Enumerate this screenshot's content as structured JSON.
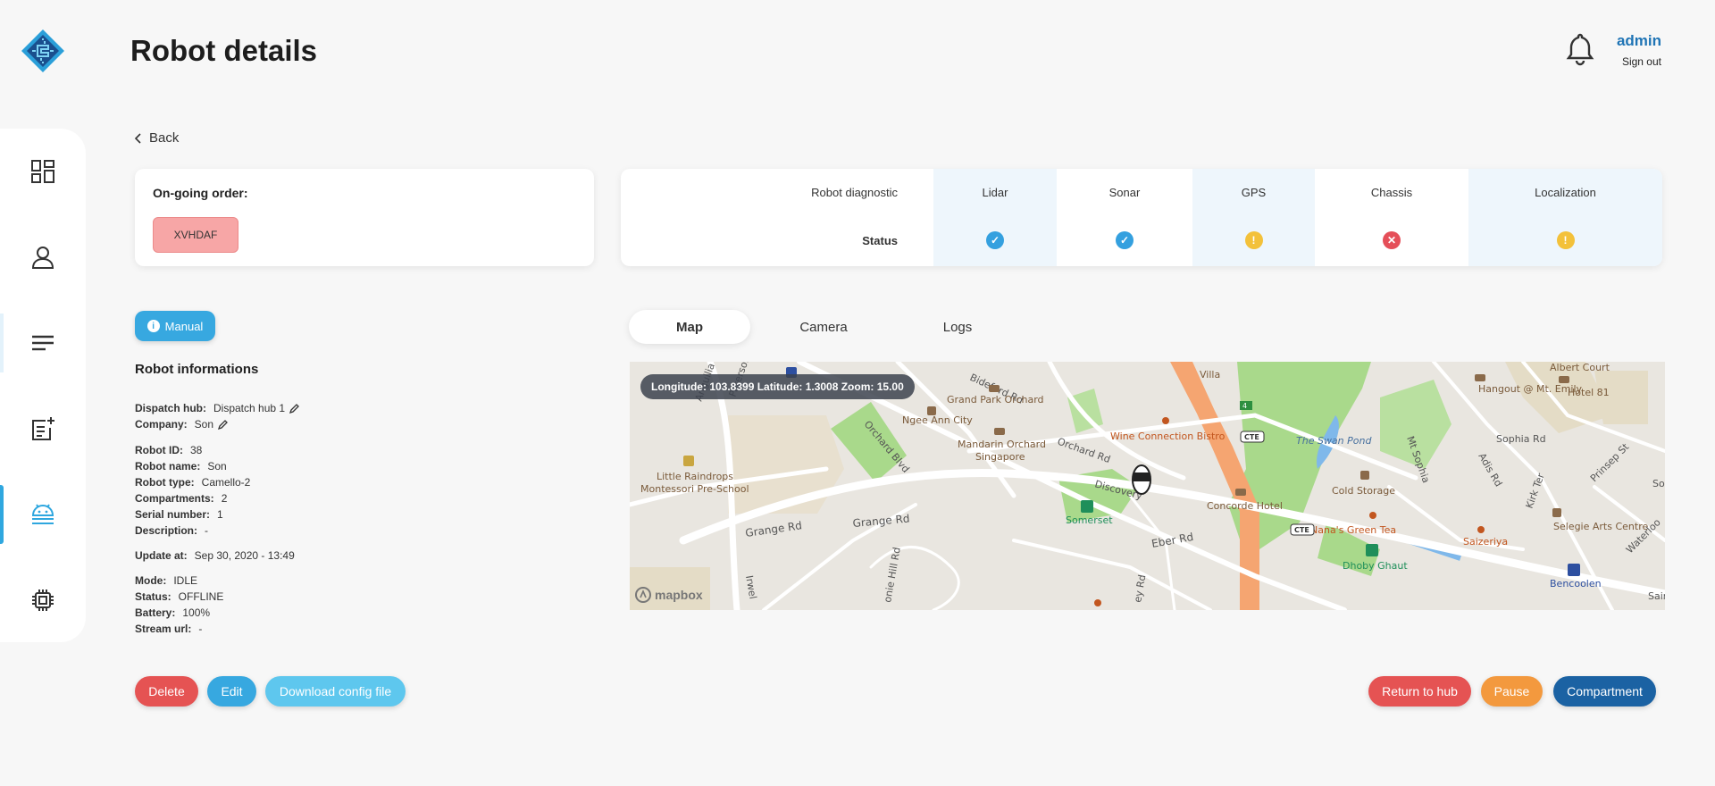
{
  "header": {
    "title": "Robot details",
    "user": "admin",
    "signout": "Sign out"
  },
  "back_label": "Back",
  "order": {
    "label": "On-going order:",
    "code": "XVHDAF"
  },
  "diagnostic": {
    "header_label": "Robot diagnostic",
    "status_label": "Status",
    "items": [
      {
        "name": "Lidar",
        "status": "ok",
        "color": "#34a0df"
      },
      {
        "name": "Sonar",
        "status": "ok",
        "color": "#34a0df"
      },
      {
        "name": "GPS",
        "status": "warning",
        "color": "#f3c13a"
      },
      {
        "name": "Chassis",
        "status": "error",
        "color": "#e54f59"
      },
      {
        "name": "Localization",
        "status": "warning",
        "color": "#f3c13a"
      }
    ]
  },
  "mode_button": "Manual",
  "info": {
    "title": "Robot informations",
    "dispatch_hub_label": "Dispatch hub:",
    "dispatch_hub": "Dispatch hub 1",
    "company_label": "Company:",
    "company": "Son",
    "robot_id_label": "Robot ID:",
    "robot_id": "38",
    "robot_name_label": "Robot name:",
    "robot_name": "Son",
    "robot_type_label": "Robot type:",
    "robot_type": "Camello-2",
    "compartments_label": "Compartments:",
    "compartments": "2",
    "serial_label": "Serial number:",
    "serial": "1",
    "description_label": "Description:",
    "description": "-",
    "update_label": "Update at:",
    "update": "Sep 30, 2020 - 13:49",
    "mode_label": "Mode:",
    "mode": "IDLE",
    "status_label": "Status:",
    "status": "OFFLINE",
    "battery_label": "Battery:",
    "battery": "100%",
    "stream_label": "Stream url:",
    "stream": "-"
  },
  "tabs": [
    "Map",
    "Camera",
    "Logs"
  ],
  "map": {
    "coords": "Longitude: 103.8399 Latitude: 1.3008 Zoom: 15.00",
    "attribution": "mapbox",
    "labels": [
      "Bideford Rd",
      "Grand Park Orchard",
      "Villa",
      "Albert Court",
      "Hangout @ Mt. Emily",
      "Hotel 81",
      "Ngee Ann City",
      "Mandarin Orchard Singapore",
      "Orchard Rd",
      "Wine Connection Bistro",
      "CTE",
      "The Swan Pond",
      "Sophia Rd",
      "Orchard Blvd",
      "Little Raindrops Montessori Pre-School",
      "Discovery",
      "Concorde Hotel",
      "Cold Storage",
      "Mt Sophia",
      "Adis Rd",
      "Kirk Ter",
      "Prinsep St",
      "Sou",
      "Somerset",
      "Nana's Green Tea",
      "Saizeriya",
      "Selegie Arts Centre",
      "Grange Rd",
      "Eber Rd",
      "Dhoby Ghaut",
      "Bencoolen",
      "Waterloo",
      "Sain",
      "Irwel",
      "onie Hill Rd",
      "ey Rd",
      "Paterson Rd",
      "Angullia"
    ]
  },
  "actions": {
    "delete": "Delete",
    "edit": "Edit",
    "download": "Download config file",
    "return_hub": "Return to hub",
    "pause": "Pause",
    "compartment": "Compartment"
  },
  "colors": {
    "primary": "#37a8e0",
    "danger": "#e55353",
    "warning": "#f3993e",
    "dark_blue": "#1b62a3",
    "light_blue": "#5ec7ee"
  }
}
